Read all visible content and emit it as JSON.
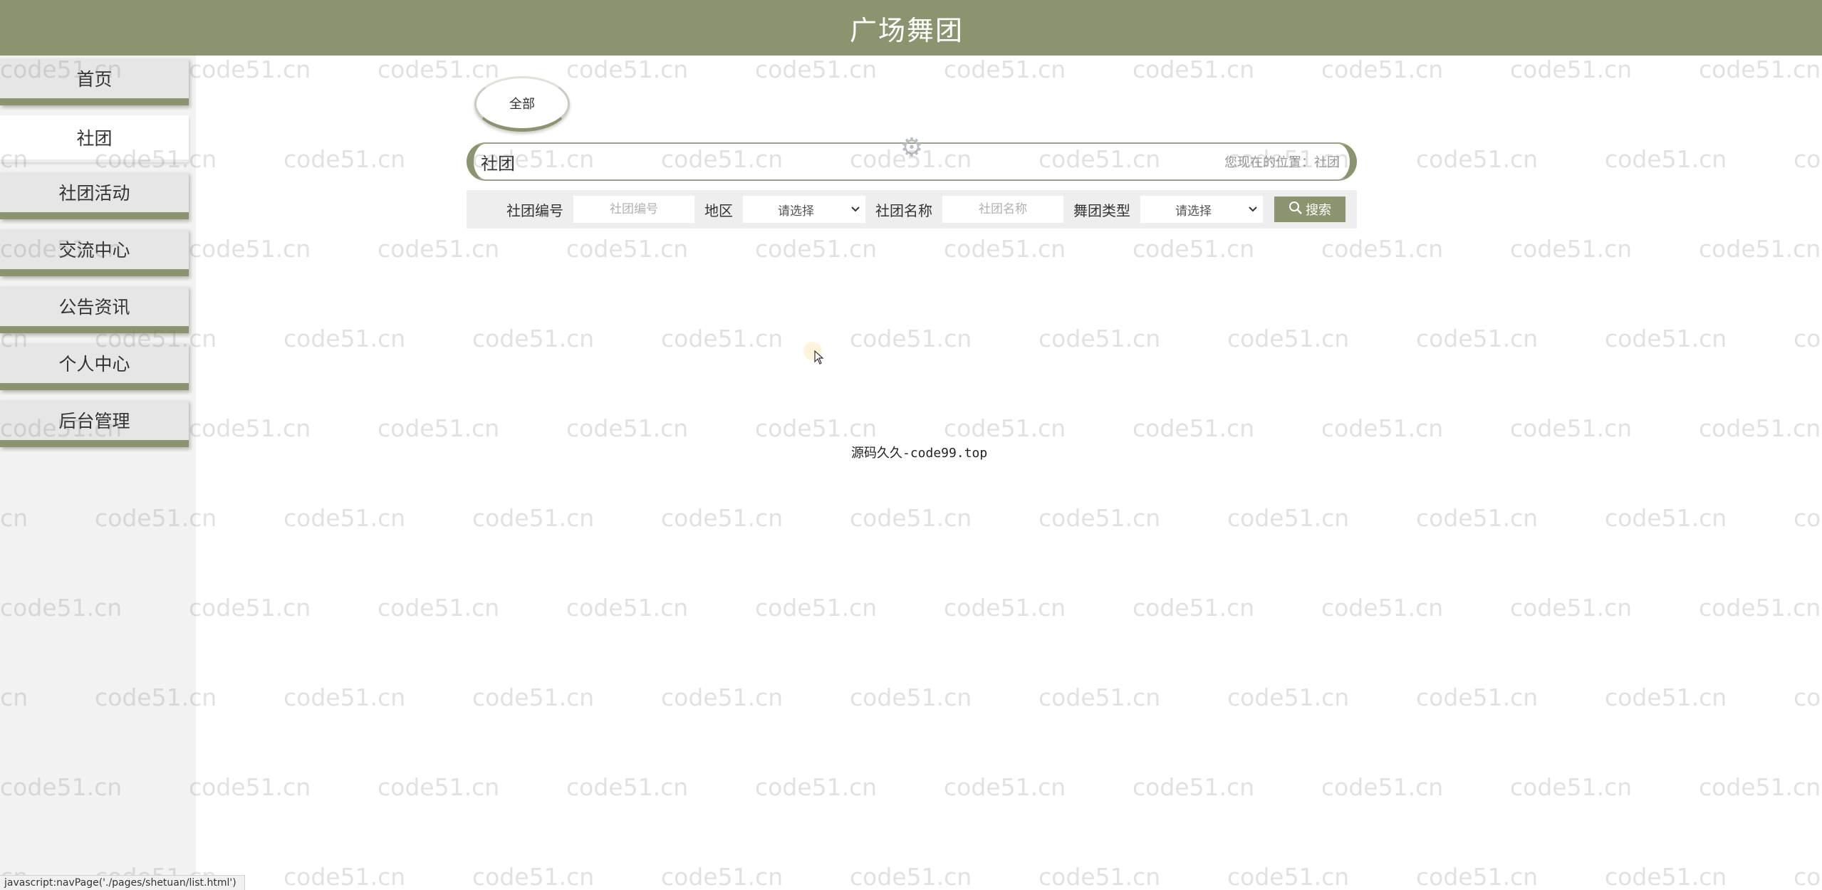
{
  "header": {
    "title": "广场舞团"
  },
  "sidebar": {
    "items": [
      {
        "label": "首页",
        "active": false
      },
      {
        "label": "社团",
        "active": true
      },
      {
        "label": "社团活动",
        "active": false
      },
      {
        "label": "交流中心",
        "active": false
      },
      {
        "label": "公告资讯",
        "active": false
      },
      {
        "label": "个人中心",
        "active": false
      },
      {
        "label": "后台管理",
        "active": false
      }
    ]
  },
  "category": {
    "label": "全部"
  },
  "breadcrumb": {
    "title": "社团",
    "location": "您现在的位置：社团"
  },
  "search": {
    "club_no_label": "社团编号",
    "club_no_placeholder": "社团编号",
    "region_label": "地区",
    "region_selected": "请选择",
    "club_name_label": "社团名称",
    "club_name_placeholder": "社团名称",
    "dance_type_label": "舞团类型",
    "dance_type_selected": "请选择",
    "search_button": "搜索"
  },
  "footer": {
    "text": "源码久久-code99.top"
  },
  "watermark": {
    "text": "code51.cn"
  },
  "status_bar": {
    "text": "javascript:navPage('./pages/shetuan/list.html')"
  },
  "colors": {
    "accent": "#8a9570",
    "sidebar_bg": "#f2f2f2",
    "search_bg": "#eeeeee"
  },
  "icons": {
    "search": "search-icon",
    "gear": "gear-icon",
    "dropdown": "chevron-down-icon",
    "cursor": "mouse-pointer-icon"
  }
}
